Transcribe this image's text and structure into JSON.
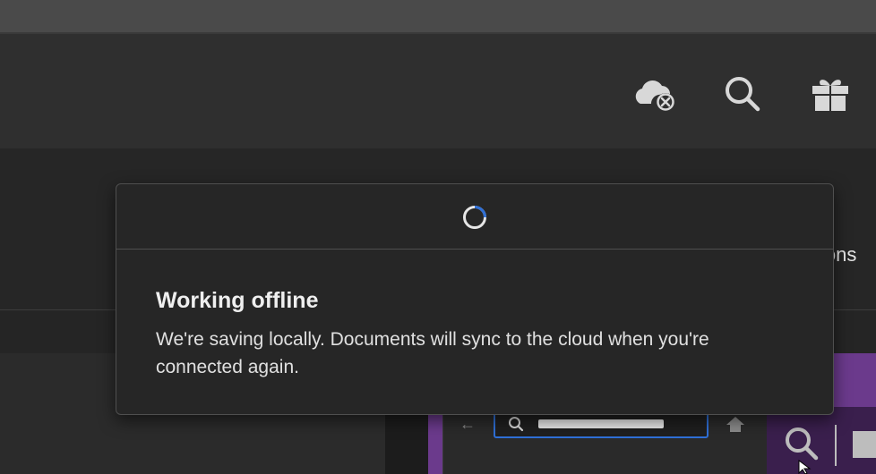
{
  "toolbar": {
    "icons": [
      "cloud-offline-icon",
      "search-icon",
      "gift-icon"
    ]
  },
  "background": {
    "clipped_text": "ions"
  },
  "dialog": {
    "title": "Working offline",
    "message": "We're saving locally. Documents will sync to the cloud when you're connected again."
  },
  "colors": {
    "accent": "#2f6fd6",
    "dialog_bg": "#262626",
    "preview_accent": "#6b3a8c"
  }
}
